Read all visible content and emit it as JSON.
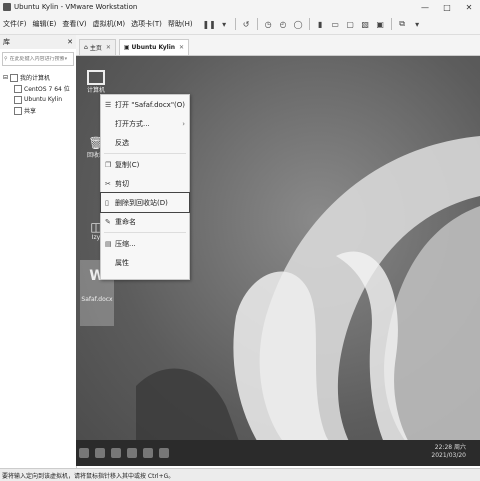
{
  "window": {
    "title": "Ubuntu Kylin - VMware Workstation"
  },
  "menubar": {
    "items": [
      "文件(F)",
      "编辑(E)",
      "查看(V)",
      "虚拟机(M)",
      "选项卡(T)",
      "帮助(H)"
    ]
  },
  "library": {
    "title": "库",
    "search_placeholder": "在此处键入内容进行搜索",
    "tree": [
      "我的计算机",
      "CentOS 7 64 位",
      "Ubuntu Kylin",
      "共享"
    ]
  },
  "tabs": [
    {
      "label": "主页"
    },
    {
      "label": "Ubuntu Kylin"
    }
  ],
  "desktop": {
    "icons": [
      "计算机",
      "回收站",
      "Izy",
      "Safaf.docx"
    ]
  },
  "context_menu": {
    "items": [
      {
        "label": "打开 \"Safaf.docx\"(O)",
        "icon": "open-icon"
      },
      {
        "label": "打开方式...",
        "icon": "",
        "submenu": true
      },
      {
        "label": "反选",
        "icon": ""
      },
      {
        "label": "复制(C)",
        "icon": "copy-icon"
      },
      {
        "label": "剪切",
        "icon": "scissors-icon"
      },
      {
        "label": "删除到回收站(D)",
        "icon": "trash-icon",
        "highlighted": true
      },
      {
        "label": "重命名",
        "icon": "rename-icon"
      },
      {
        "label": "压缩...",
        "icon": "compress-icon"
      },
      {
        "label": "属性",
        "icon": ""
      }
    ]
  },
  "taskbar": {
    "time": "22:28 周六",
    "date": "2021/03/20"
  },
  "statusbar": {
    "text": "要将输入定向到该虚拟机，请将鼠标指针移入其中或按 Ctrl+G。"
  }
}
